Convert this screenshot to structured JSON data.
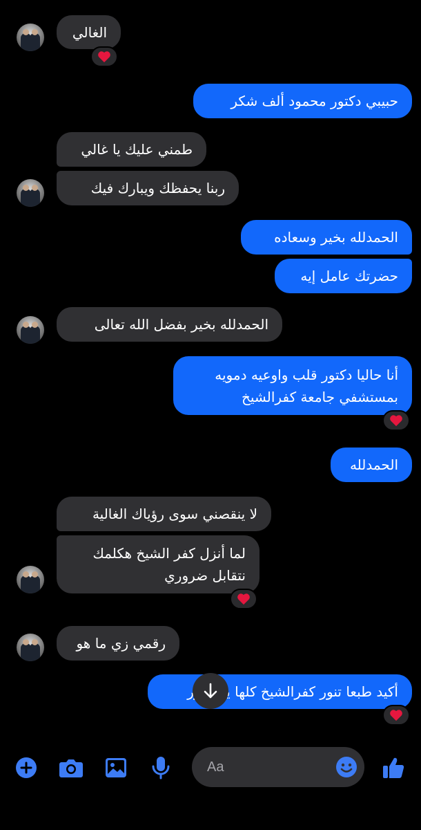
{
  "messages": [
    {
      "text": "الغالي",
      "direction": "incoming",
      "reaction": "heart"
    },
    {
      "text": "حبيبي دكتور محمود ألف شكر",
      "direction": "outgoing"
    },
    {
      "text": "طمني عليك يا غالي",
      "direction": "incoming"
    },
    {
      "text": "ربنا يحفظك ويبارك فيك",
      "direction": "incoming"
    },
    {
      "text": "الحمدلله بخير وسعاده",
      "direction": "outgoing"
    },
    {
      "text": "حضرتك عامل إيه",
      "direction": "outgoing"
    },
    {
      "text": "الحمدلله بخير بفضل الله تعالى",
      "direction": "incoming"
    },
    {
      "lines": [
        "أنا حاليا دكتور قلب واوعيه دمويه",
        "بمستشفي جامعة كفرالشيخ"
      ],
      "direction": "outgoing",
      "reaction": "heart"
    },
    {
      "text": "الحمدلله",
      "direction": "outgoing"
    },
    {
      "text": "لا ينقصني سوى رؤياك الغالية",
      "direction": "incoming"
    },
    {
      "lines": [
        "لما أنزل كفر الشيخ هكلمك",
        "نتقابل ضروري"
      ],
      "direction": "incoming",
      "reaction": "heart"
    },
    {
      "text": "رقمي زي ما هو",
      "direction": "incoming"
    },
    {
      "text": "أكيد طبعا تنور كفرالشيخ كلها يا دكتور",
      "direction": "outgoing",
      "reaction": "heart"
    }
  ],
  "composer": {
    "placeholder": "Aa",
    "icons": [
      "plus-icon",
      "camera-icon",
      "gallery-icon",
      "microphone-icon",
      "emoji-icon",
      "thumbs-up-icon"
    ]
  },
  "colors": {
    "background": "#000000",
    "incoming_bubble": "#303033",
    "outgoing_bubble": "#1268fb",
    "accent": "#3d7cf5",
    "heart": "#e5173f"
  }
}
